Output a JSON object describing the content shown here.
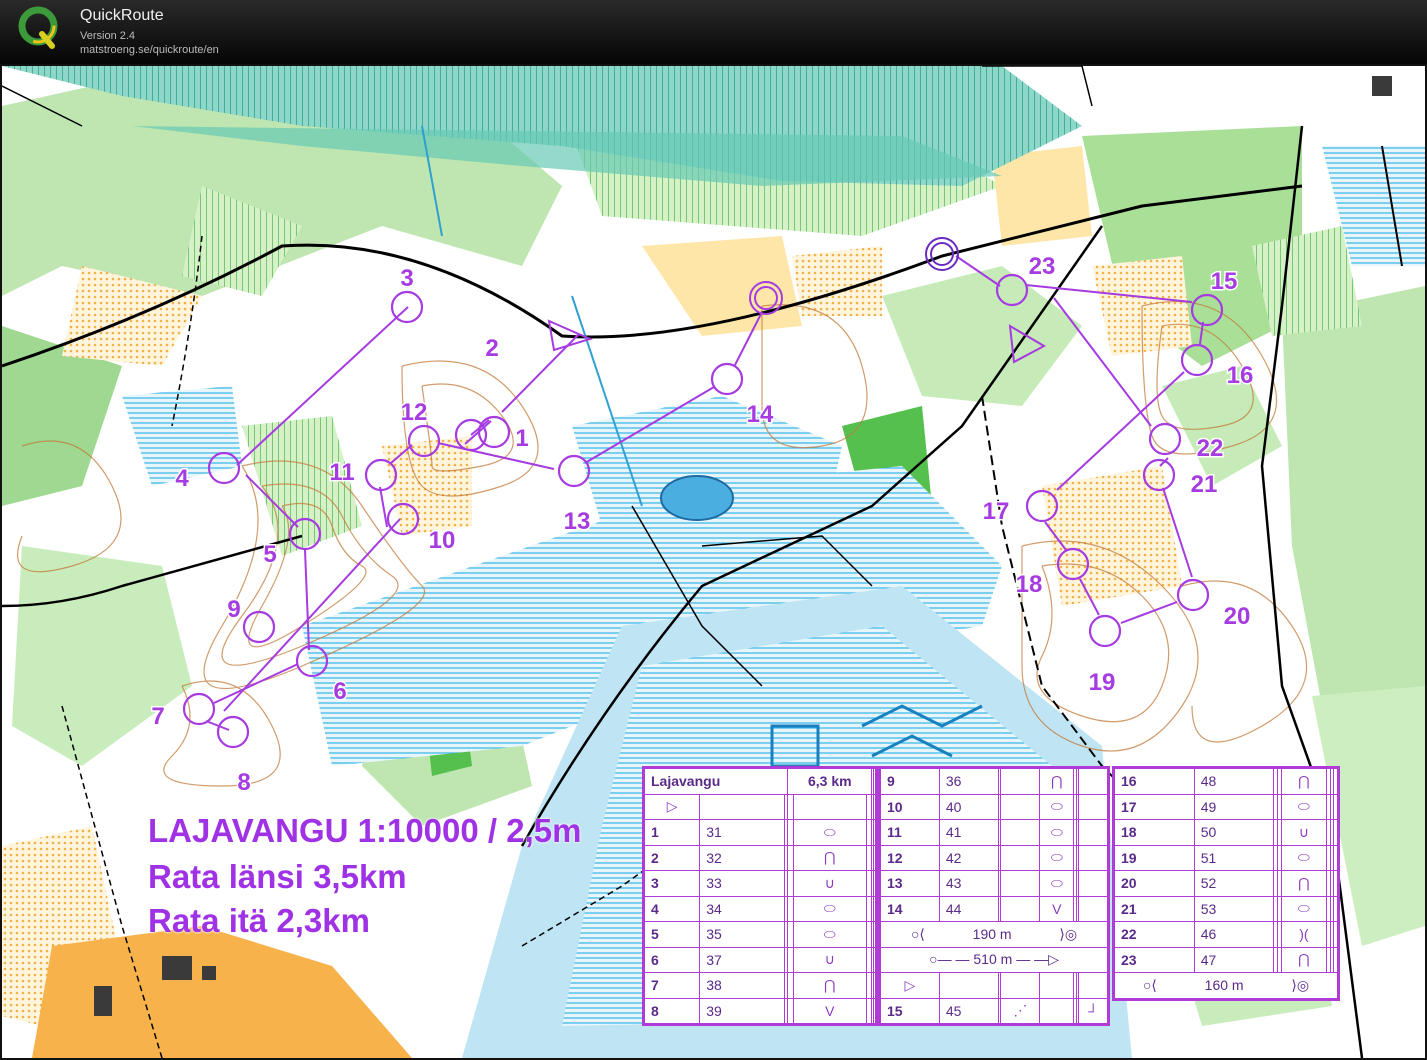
{
  "app": {
    "title": "QuickRoute",
    "version": "Version 2.4",
    "url": "matstroeng.se/quickroute/en"
  },
  "map": {
    "title_lines": [
      "LAJAVANGU 1:10000 / 2,5m",
      "Rata länsi 3,5km",
      "Rata itä 2,3km"
    ],
    "course_color": "#a53be0",
    "controls": [
      {
        "label": "1"
      },
      {
        "label": "2"
      },
      {
        "label": "3"
      },
      {
        "label": "4"
      },
      {
        "label": "5"
      },
      {
        "label": "6"
      },
      {
        "label": "7"
      },
      {
        "label": "8"
      },
      {
        "label": "9"
      },
      {
        "label": "10"
      },
      {
        "label": "11"
      },
      {
        "label": "12"
      },
      {
        "label": "13"
      },
      {
        "label": "14"
      },
      {
        "label": "15"
      },
      {
        "label": "16"
      },
      {
        "label": "17"
      },
      {
        "label": "18"
      },
      {
        "label": "19"
      },
      {
        "label": "20"
      },
      {
        "label": "21"
      },
      {
        "label": "22"
      },
      {
        "label": "23"
      }
    ]
  },
  "descriptions": {
    "sheet1": {
      "header_name": "Lajavangu",
      "header_length": "6,3 km",
      "rows": [
        {
          "num": "1",
          "code": "31",
          "sym": "⬭"
        },
        {
          "num": "2",
          "code": "32",
          "sym": "⋂"
        },
        {
          "num": "3",
          "code": "33",
          "sym": "∪"
        },
        {
          "num": "4",
          "code": "34",
          "sym": "⬭"
        },
        {
          "num": "5",
          "code": "35",
          "sym": "⬭"
        },
        {
          "num": "6",
          "code": "37",
          "sym": "∪"
        },
        {
          "num": "7",
          "code": "38",
          "sym": "⋂"
        },
        {
          "num": "8",
          "code": "39",
          "sym": "V"
        }
      ]
    },
    "sheet2": {
      "rows": [
        {
          "num": "9",
          "code": "36",
          "sym": "⋂"
        },
        {
          "num": "10",
          "code": "40",
          "sym": "⬭"
        },
        {
          "num": "11",
          "code": "41",
          "sym": "⬭"
        },
        {
          "num": "12",
          "code": "42",
          "sym": "⬭"
        },
        {
          "num": "13",
          "code": "43",
          "sym": "⬭"
        },
        {
          "num": "14",
          "code": "44",
          "sym": "V"
        }
      ],
      "leg1": "190 m",
      "leg2": "510 m",
      "last_row": {
        "num": "15",
        "code": "45"
      }
    },
    "sheet3": {
      "rows": [
        {
          "num": "16",
          "code": "48",
          "sym": "⋂"
        },
        {
          "num": "17",
          "code": "49",
          "sym": "⬭"
        },
        {
          "num": "18",
          "code": "50",
          "sym": "∪"
        },
        {
          "num": "19",
          "code": "51",
          "sym": "⬭"
        },
        {
          "num": "20",
          "code": "52",
          "sym": "⋂"
        },
        {
          "num": "21",
          "code": "53",
          "sym": "⬭"
        },
        {
          "num": "22",
          "code": "46",
          "sym": ")("
        },
        {
          "num": "23",
          "code": "47",
          "sym": "⋂"
        }
      ],
      "finish_leg": "160 m"
    }
  }
}
